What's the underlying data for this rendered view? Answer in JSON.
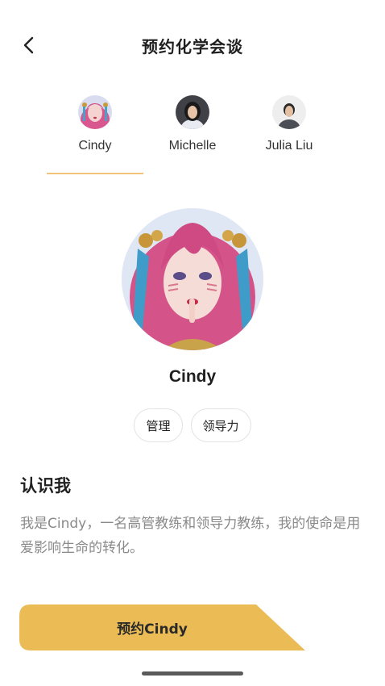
{
  "header": {
    "title": "预约化学会谈",
    "back_icon": "chevron-left-icon"
  },
  "tabs": [
    {
      "name": "Cindy",
      "selected": true
    },
    {
      "name": "Michelle",
      "selected": false
    },
    {
      "name": "Julia Liu",
      "selected": false
    }
  ],
  "profile": {
    "name": "Cindy",
    "tags": [
      "管理",
      "领导力"
    ]
  },
  "about": {
    "title": "认识我",
    "body": "我是Cindy，一名高管教练和领导力教练，我的使命是用爱影响生命的转化。"
  },
  "book_button": {
    "label": "预约Cindy"
  },
  "colors": {
    "accent": "#ebbc55",
    "tab_indicator": "#f0c27a",
    "muted_text": "#8a8a8a"
  }
}
